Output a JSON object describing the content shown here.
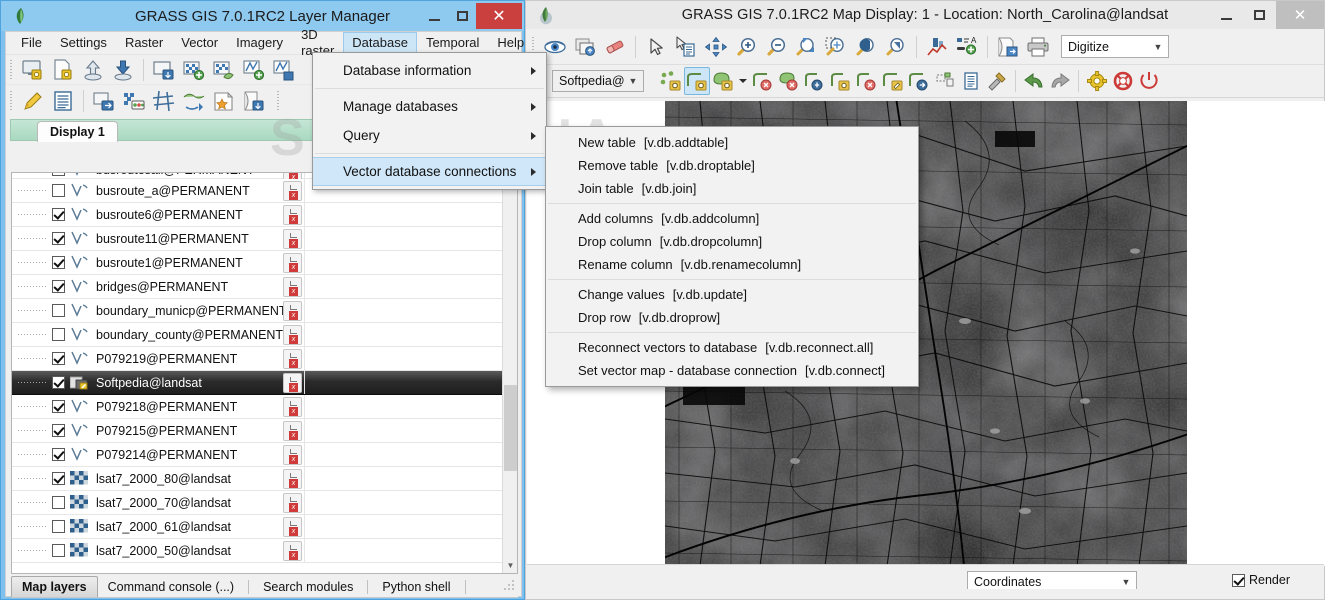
{
  "layer_manager": {
    "title": "GRASS GIS 7.0.1RC2 Layer Manager",
    "window_buttons": {
      "minimize": "–",
      "maximize": "□",
      "close": "✕"
    },
    "menubar": [
      {
        "label": "File",
        "active": false
      },
      {
        "label": "Settings",
        "active": false
      },
      {
        "label": "Raster",
        "active": false
      },
      {
        "label": "Vector",
        "active": false
      },
      {
        "label": "Imagery",
        "active": false
      },
      {
        "label": "3D raster",
        "active": false
      },
      {
        "label": "Database",
        "active": true
      },
      {
        "label": "Temporal",
        "active": false
      },
      {
        "label": "Help",
        "active": false
      }
    ],
    "notebook_tab": "Display 1",
    "layers": [
      {
        "name": "busroutesall@PERMANENT",
        "checked": false,
        "type": "vector",
        "partial": true
      },
      {
        "name": "busroute_a@PERMANENT",
        "checked": false,
        "type": "vector"
      },
      {
        "name": "busroute6@PERMANENT",
        "checked": true,
        "type": "vector"
      },
      {
        "name": "busroute11@PERMANENT",
        "checked": true,
        "type": "vector"
      },
      {
        "name": "busroute1@PERMANENT",
        "checked": true,
        "type": "vector"
      },
      {
        "name": "bridges@PERMANENT",
        "checked": true,
        "type": "vector"
      },
      {
        "name": "boundary_municp@PERMANENT",
        "checked": false,
        "type": "vector"
      },
      {
        "name": "boundary_county@PERMANENT",
        "checked": false,
        "type": "vector"
      },
      {
        "name": "P079219@PERMANENT",
        "checked": true,
        "type": "vector"
      },
      {
        "name": "Softpedia@landsat",
        "checked": true,
        "type": "edit",
        "selected": true
      },
      {
        "name": "P079218@PERMANENT",
        "checked": true,
        "type": "vector"
      },
      {
        "name": "P079215@PERMANENT",
        "checked": true,
        "type": "vector"
      },
      {
        "name": "P079214@PERMANENT",
        "checked": true,
        "type": "vector"
      },
      {
        "name": "lsat7_2000_80@landsat",
        "checked": true,
        "type": "raster"
      },
      {
        "name": "lsat7_2000_70@landsat",
        "checked": false,
        "type": "raster"
      },
      {
        "name": "lsat7_2000_61@landsat",
        "checked": false,
        "type": "raster"
      },
      {
        "name": "lsat7_2000_50@landsat",
        "checked": false,
        "type": "raster"
      }
    ],
    "bottom_tabs": [
      {
        "label": "Map layers",
        "active": true
      },
      {
        "label": "Command console (...)",
        "active": false
      },
      {
        "label": "Search modules",
        "active": false
      },
      {
        "label": "Python shell",
        "active": false
      }
    ],
    "toolbar_row1_icons": [
      "new-workspace-icon",
      "open-workspace-icon",
      "load-workspace-icon",
      "save-workspace-icon",
      "import-raster-icon",
      "add-raster-layer-icon",
      "add-multiple-raster-icon",
      "add-vector-layer-icon",
      "add-multiple-vector-icon"
    ],
    "toolbar_row2_icons": [
      "edit-pencil-icon",
      "attribute-table-icon",
      "add-command-layer-icon",
      "raster-calculator-icon",
      "georectify-icon",
      "vector-network-icon",
      "add-legend-icon",
      "save-display-icon"
    ]
  },
  "database_menu": {
    "items": [
      {
        "label": "Database information",
        "submenu": true,
        "highlighted": false
      },
      {
        "separator": true
      },
      {
        "label": "Manage databases",
        "submenu": true,
        "highlighted": false
      },
      {
        "label": "Query",
        "submenu": true,
        "highlighted": false
      },
      {
        "separator": true
      },
      {
        "label": "Vector database connections",
        "submenu": true,
        "highlighted": true
      }
    ]
  },
  "vector_db_submenu": {
    "groups": [
      [
        {
          "label": "New table",
          "command": "[v.db.addtable]"
        },
        {
          "label": "Remove table",
          "command": "[v.db.droptable]"
        },
        {
          "label": "Join table",
          "command": "[v.db.join]"
        }
      ],
      [
        {
          "label": "Add columns",
          "command": "[v.db.addcolumn]"
        },
        {
          "label": "Drop column",
          "command": "[v.db.dropcolumn]"
        },
        {
          "label": "Rename column",
          "command": "[v.db.renamecolumn]"
        }
      ],
      [
        {
          "label": "Change values",
          "command": "[v.db.update]"
        },
        {
          "label": "Drop row",
          "command": "[v.db.droprow]"
        }
      ],
      [
        {
          "label": "Reconnect vectors to database",
          "command": "[v.db.reconnect.all]"
        },
        {
          "label": "Set vector map - database connection",
          "command": "[v.db.connect]"
        }
      ]
    ]
  },
  "map_display": {
    "title": "GRASS GIS 7.0.1RC2 Map Display: 1  - Location: North_Carolina@landsat",
    "window_buttons": {
      "minimize": "–",
      "maximize": "□",
      "close": "✕"
    },
    "toolbar_icons": [
      "display-map-icon",
      "render-map-icon",
      "erase-display-icon",
      "pointer-icon",
      "query-raster-vector-icon",
      "pan-icon",
      "zoom-in-icon",
      "zoom-out-icon",
      "zoom-to-extent-icon",
      "zoom-to-selected-icon",
      "zoom-back-icon",
      "zoom-menu-icon",
      "analyze-map-icon",
      "add-map-elements-icon",
      "save-display-to-file-icon",
      "print-map-icon"
    ],
    "mode_select": {
      "value": "Digitize"
    },
    "digitize_toolbar": {
      "map_select": {
        "value": "Softpedia@"
      },
      "icons": [
        "digitize-point-icon",
        "digitize-line-icon",
        "digitize-area-icon",
        "digitize-more-dropdown-icon",
        "delete-line-icon",
        "delete-area-icon",
        "move-vertex-icon",
        "add-vertex-icon",
        "remove-vertex-icon",
        "edit-line-icon",
        "move-feature-icon",
        "copy-feature-icon",
        "attribute-table-icon",
        "digitize-settings-icon",
        "undo-icon",
        "redo-icon",
        "settings-gear-icon",
        "help-icon",
        "quit-digitizer-icon"
      ]
    },
    "status_bar": {
      "select_value": "Coordinates",
      "render_label": "Render",
      "render_checked": true
    }
  },
  "watermark": "SOFTPEDIA",
  "colors": {
    "lm_title_bg": "#8ec9ef",
    "lm_border": "#4da3dd",
    "close_red": "#c9403e",
    "menu_highlight": "#cfe7f8",
    "tab_green": "#a9d9c0",
    "toolbar_bg": "#f0f0f0",
    "selected_row": "#2b2b2b",
    "map_dark": "#2a2a2a"
  }
}
